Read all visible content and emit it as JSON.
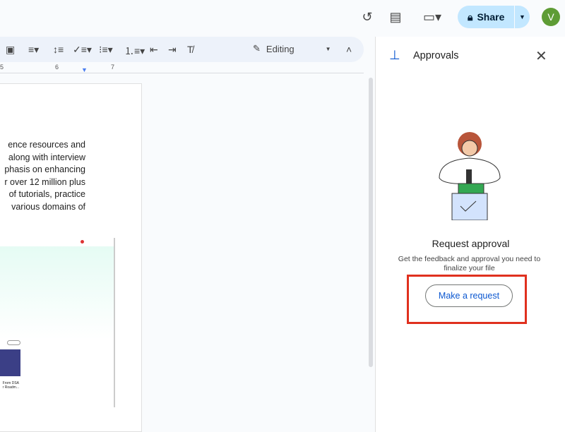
{
  "header": {
    "share_label": "Share",
    "avatar_letter": "V"
  },
  "toolbar": {
    "mode_label": "Editing"
  },
  "ruler": {
    "ticks": [
      "5",
      "6",
      "7"
    ]
  },
  "document": {
    "lines": [
      "ence resources and",
      "along with interview",
      "phasis on enhancing",
      "r over 12 million plus",
      "of tutorials, practice",
      "various domains of"
    ],
    "embed_caption": [
      "From DSA",
      "r Roadm..."
    ]
  },
  "panel": {
    "title": "Approvals",
    "heading": "Request approval",
    "description": "Get the feedback and approval you need to finalize your file",
    "button_label": "Make a request"
  }
}
